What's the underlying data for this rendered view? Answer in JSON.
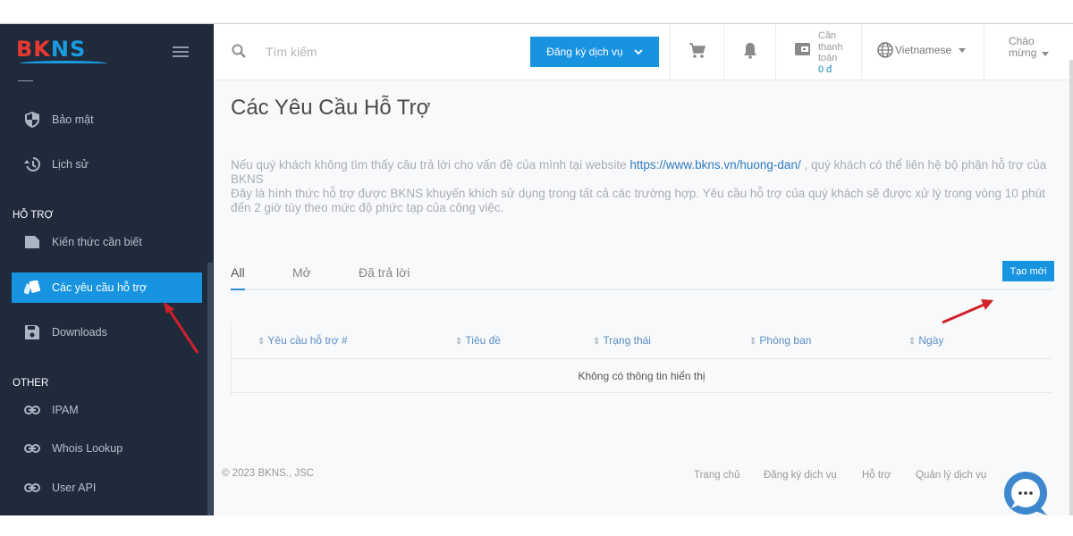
{
  "brand": {
    "logo_part1": "BK",
    "logo_part2": "NS",
    "accent": "#1893e0",
    "sidebar_bg": "#1f2a3b"
  },
  "sidebar": {
    "items_top": [
      {
        "label": "Bảo mật",
        "icon": "shield-icon"
      },
      {
        "label": "Lịch sử",
        "icon": "history-icon"
      }
    ],
    "section_support": "HỖ TRỢ",
    "items_support": [
      {
        "label": "Kiến thức cần biết",
        "icon": "document-icon"
      },
      {
        "label": "Các yêu cầu hỗ trợ",
        "icon": "tickets-icon",
        "active": true
      },
      {
        "label": "Downloads",
        "icon": "floppy-disk-icon"
      }
    ],
    "section_other": "OTHER",
    "items_other": [
      {
        "label": "IPAM",
        "icon": "link-icon"
      },
      {
        "label": "Whois Lookup",
        "icon": "link-icon"
      },
      {
        "label": "User API",
        "icon": "link-icon"
      }
    ]
  },
  "topbar": {
    "search_placeholder": "Tìm kiếm",
    "register_label": "Đăng ký dịch vụ",
    "due_line1": "Cần",
    "due_line2": "thanh",
    "due_line3": "toán",
    "due_amount": "0 đ",
    "language": "Vietnamese",
    "greeting_line1": "Chào",
    "greeting_line2": "mừng"
  },
  "main": {
    "title": "Các Yêu Cầu Hỗ Trợ",
    "intro_part1": "Nếu quý khách không tìm thấy câu trả lời cho vấn đề của mình tại website ",
    "intro_link": "https://www.bkns.vn/huong-dan/",
    "intro_part2": " , quý khách có thể liên hệ bộ phận hỗ trợ của BKNS",
    "intro_line2": "Đây là hình thức hỗ trợ được BKNS khuyến khích sử dụng trong tất cả các trường hợp. Yêu cầu hỗ trợ của quý khách sẽ được xử lý trong vòng 10 phút đến 2 giờ tùy theo mức độ phức tạp của công việc.",
    "tabs": [
      {
        "label": "All",
        "active": true
      },
      {
        "label": "Mở"
      },
      {
        "label": "Đã trả lời"
      }
    ],
    "new_button": "Tạo mới",
    "table": {
      "columns": [
        "Yêu cầu hỗ trợ #",
        "Tiêu đề",
        "Trạng thái",
        "Phòng ban",
        "Ngày"
      ],
      "sort_glyph": "⇕",
      "empty_message": "Không có thông tin hiển thị"
    }
  },
  "footer": {
    "copyright": "© 2023 BKNS., JSC",
    "links": [
      "Trang chủ",
      "Đăng ký dịch vụ",
      "Hỗ trợ",
      "Quản lý dịch vụ"
    ]
  }
}
